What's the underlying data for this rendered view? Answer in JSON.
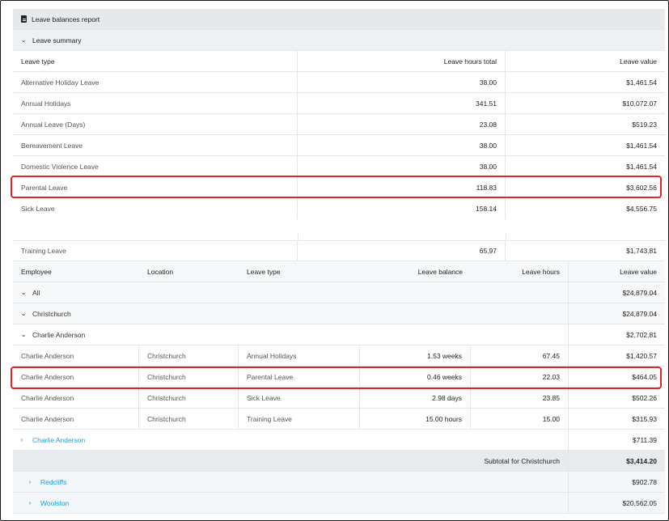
{
  "report": {
    "title": "Leave balances report",
    "summary_label": "Leave summary"
  },
  "summary": {
    "headers": [
      "Leave type",
      "Leave hours total",
      "Leave value"
    ],
    "rows": [
      {
        "type": "Alternative Holiday Leave",
        "hours": "38.00",
        "value": "$1,461.54"
      },
      {
        "type": "Annual Holidays",
        "hours": "341.51",
        "value": "$10,072.07"
      },
      {
        "type": "Annual Leave (Days)",
        "hours": "23.08",
        "value": "$519.23"
      },
      {
        "type": "Bereavement Leave",
        "hours": "38.00",
        "value": "$1,461.54"
      },
      {
        "type": "Domestic Violence Leave",
        "hours": "38.00",
        "value": "$1,461.54"
      },
      {
        "type": "Parental Leave",
        "hours": "118.83",
        "value": "$3,602.56"
      },
      {
        "type": "Sick Leave",
        "hours": "158.14",
        "value": "$4,556.75"
      },
      {
        "type": "Training Leave",
        "hours": "65.97",
        "value": "$1,743.81"
      }
    ]
  },
  "detail": {
    "headers": [
      "Employee",
      "Location",
      "Leave type",
      "Leave balance",
      "Leave hours",
      "Leave value"
    ],
    "all": {
      "label": "All",
      "value": "$24,879.04"
    },
    "christchurch": {
      "label": "Christchurch",
      "value": "$24,879.04"
    },
    "charlie_group": {
      "label": "Charlie Anderson",
      "value": "$2,702.81"
    },
    "rows": [
      {
        "employee": "Charlie Anderson",
        "location": "Christchurch",
        "type": "Annual Holidays",
        "balance": "1.53 weeks",
        "hours": "67.45",
        "value": "$1,420.57"
      },
      {
        "employee": "Charlie Anderson",
        "location": "Christchurch",
        "type": "Parental Leave",
        "balance": "0.46 weeks",
        "hours": "22.03",
        "value": "$464.05"
      },
      {
        "employee": "Charlie Anderson",
        "location": "Christchurch",
        "type": "Sick Leave",
        "balance": "2.98 days",
        "hours": "23.85",
        "value": "$502.26"
      },
      {
        "employee": "Charlie Anderson",
        "location": "Christchurch",
        "type": "Training Leave",
        "balance": "15.00 hours",
        "hours": "15.00",
        "value": "$315.93"
      }
    ],
    "charlie_collapsed": {
      "label": "Charlie Anderson",
      "value": "$711.39"
    },
    "subtotal": {
      "label": "Subtotal for Christchurch",
      "value": "$3,414.20"
    },
    "redcliffs": {
      "label": "Redcliffs",
      "value": "$902.78"
    },
    "woolston": {
      "label": "Woolston",
      "value": "$20,562.05"
    }
  },
  "colors": {
    "highlight": "#e3232c",
    "link": "#1aa0d8",
    "title_bg": "#e5e9ec"
  }
}
